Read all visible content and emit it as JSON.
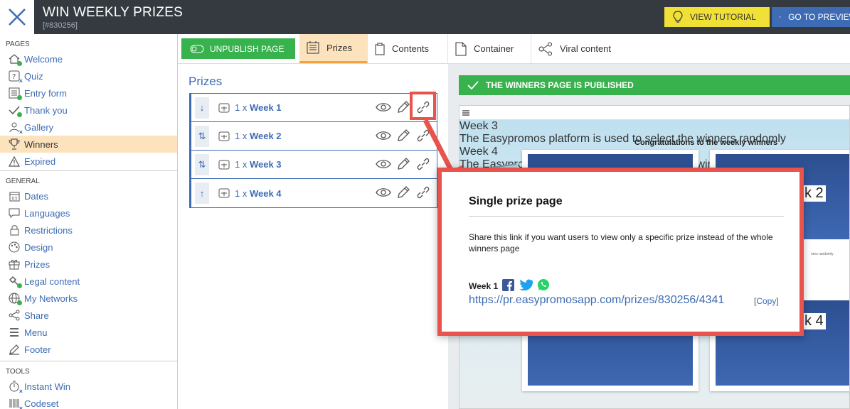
{
  "header": {
    "title": "WIN WEEKLY PRIZES",
    "id": "[#830256]",
    "tutorial_label": "VIEW TUTORIAL",
    "preview_label": "GO TO PREVIEW"
  },
  "sidebar": {
    "pages_label": "PAGES",
    "pages": [
      {
        "label": "Welcome",
        "icon": "home-icon"
      },
      {
        "label": "Quiz",
        "icon": "question-icon"
      },
      {
        "label": "Entry form",
        "icon": "form-icon"
      },
      {
        "label": "Thank you",
        "icon": "check-icon"
      },
      {
        "label": "Gallery",
        "icon": "gallery-icon"
      },
      {
        "label": "Winners",
        "icon": "trophy-icon"
      },
      {
        "label": "Expired",
        "icon": "warning-icon"
      }
    ],
    "general_label": "GENERAL",
    "general": [
      {
        "label": "Dates",
        "icon": "calendar-icon"
      },
      {
        "label": "Languages",
        "icon": "speech-icon"
      },
      {
        "label": "Restrictions",
        "icon": "lock-icon"
      },
      {
        "label": "Design",
        "icon": "palette-icon"
      },
      {
        "label": "Prizes",
        "icon": "gift-icon"
      },
      {
        "label": "Legal content",
        "icon": "gavel-icon"
      },
      {
        "label": "My Networks",
        "icon": "globe-icon"
      },
      {
        "label": "Share",
        "icon": "share-icon"
      },
      {
        "label": "Menu",
        "icon": "menu-icon"
      },
      {
        "label": "Footer",
        "icon": "pen-icon"
      }
    ],
    "tools_label": "TOOLS",
    "tools": [
      {
        "label": "Instant Win",
        "icon": "timer-icon"
      },
      {
        "label": "Codeset",
        "icon": "barcode-icon"
      }
    ]
  },
  "toolbar": {
    "unpublish_label": "UNPUBLISH PAGE",
    "tabs": [
      {
        "label": "Prizes"
      },
      {
        "label": "Contents"
      },
      {
        "label": "Container"
      },
      {
        "label": "Viral content"
      }
    ]
  },
  "prizes": {
    "heading": "Prizes",
    "qty": "1 x",
    "items": [
      {
        "name": "Week 1",
        "handle": "↓"
      },
      {
        "name": "Week 2",
        "handle": "⇅"
      },
      {
        "name": "Week 3",
        "handle": "⇅"
      },
      {
        "name": "Week 4",
        "handle": "↑"
      }
    ]
  },
  "preview": {
    "published_text": "THE WINNERS PAGE IS PUBLISHED",
    "page_title": "Congratulations to the weekly winners",
    "tag_2": "k 2",
    "tag_4": "k 4",
    "card_desc": "The Easypromos platform is used to select the winners randomly",
    "card3_title": "Week 3",
    "card4_title": "Week 4",
    "card_side_text": "ners randomly"
  },
  "popup": {
    "title": "Single prize page",
    "description": "Share this link if you want users to view only a specific prize instead of the whole winners page",
    "week": "Week 1",
    "link": "https://pr.easypromosapp.com/prizes/830256/4341",
    "copy_open": "[",
    "copy_label": "Copy",
    "copy_close": "]"
  },
  "colors": {
    "topbar": "#343a40",
    "accent_blue": "#3d6cb4",
    "green": "#37b24d",
    "yellow": "#f1e036",
    "active_bg": "#fde3bd",
    "annotation_red": "#e8534c"
  }
}
